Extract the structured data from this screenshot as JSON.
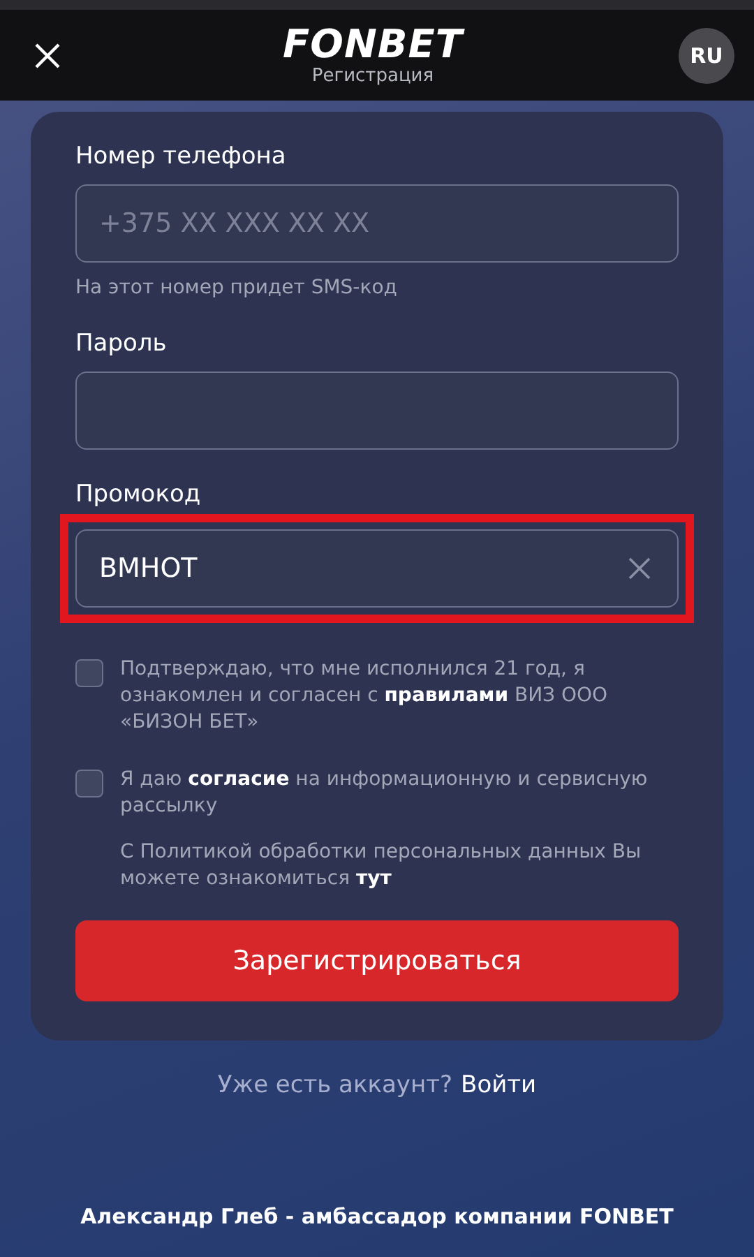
{
  "header": {
    "logo": "FONBET",
    "subtitle": "Регистрация",
    "language": "RU"
  },
  "fields": [
    {
      "label": "Номер телефона",
      "placeholder": "+375 XX XXX XX XX",
      "hint": "На этот номер придет SMS-код",
      "clearable": false,
      "highlighted": false
    },
    {
      "label": "Пароль",
      "clearable": false,
      "highlighted": false
    },
    {
      "label": "Промокод",
      "value": "ВМНОТ",
      "clearable": true,
      "highlighted": true
    }
  ],
  "consents": [
    {
      "text": "Подтверждаю, что мне исполнился 21 год, я ознакомлен и согласен с **правилами** ВИЗ ООО «БИЗОН БЕТ»",
      "checked": false
    },
    {
      "text": "Я даю **согласие** на информационную и сервисную рассылку",
      "checked": false
    }
  ],
  "privacy_note": "С Политикой обработки персональных данных Вы можете ознакомиться **тут**",
  "submit": "Зарегистрироваться",
  "login_prompt": "Уже есть аккаунт?",
  "login_link": "Войти",
  "footer": "Александр Глеб - амбассадор компании FONBET"
}
